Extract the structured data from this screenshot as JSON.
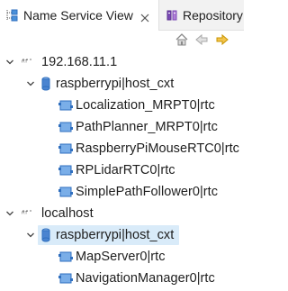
{
  "tabs": [
    {
      "label": "Name Service View",
      "icon": "name-service-icon",
      "active": true
    },
    {
      "label": "Repository",
      "icon": "repository-icon",
      "active": false
    }
  ],
  "toolbar": {
    "buttons": [
      {
        "name": "home-button",
        "icon": "home-icon"
      },
      {
        "name": "back-button",
        "icon": "arrow-left-icon"
      },
      {
        "name": "forward-button",
        "icon": "arrow-right-icon"
      }
    ]
  },
  "tree": {
    "hosts": [
      {
        "label": "192.168.11.1",
        "expanded": true,
        "managers": [
          {
            "label": "raspberrypi|host_cxt",
            "expanded": true,
            "selected": false,
            "components": [
              "Localization_MRPT0|rtc",
              "PathPlanner_MRPT0|rtc",
              "RaspberryPiMouseRTC0|rtc",
              "RPLidarRTC0|rtc",
              "SimplePathFollower0|rtc"
            ]
          }
        ]
      },
      {
        "label": "localhost",
        "expanded": true,
        "managers": [
          {
            "label": "raspberrypi|host_cxt",
            "expanded": true,
            "selected": true,
            "components": [
              "MapServer0|rtc",
              "NavigationManager0|rtc"
            ]
          }
        ]
      }
    ]
  },
  "colors": {
    "selection": "#d9ebf9",
    "accent": "#2f6fbf",
    "forward_arrow": "#e0a000"
  }
}
